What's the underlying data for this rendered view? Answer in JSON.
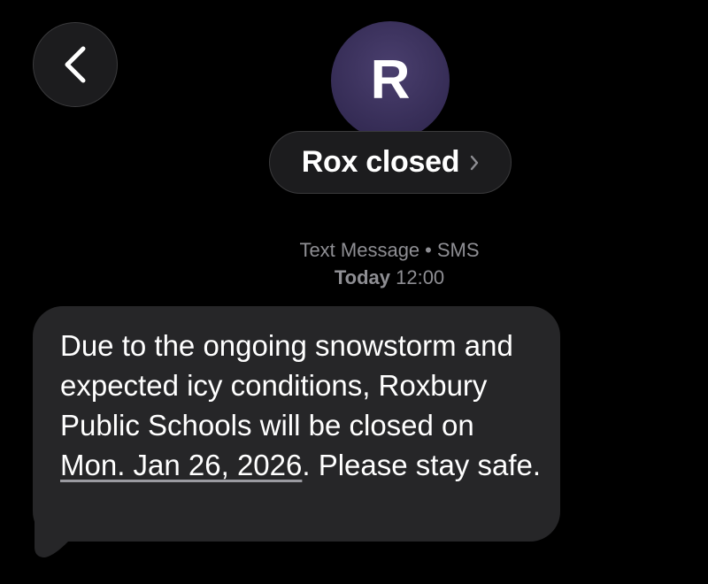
{
  "header": {
    "back_icon": "chevron-left-icon",
    "avatar_initial": "R",
    "avatar_color": "#352c55",
    "contact_name": "Rox closed",
    "contact_chevron_icon": "chevron-right-icon"
  },
  "meta": {
    "service": "Text Message",
    "separator": "•",
    "protocol": "SMS",
    "day": "Today",
    "time": "12:00"
  },
  "message": {
    "text_before": "Due to the ongoing snowstorm and expected icy conditions, Roxbury Public Schools will be closed on ",
    "date_link": "Mon. Jan 26, 2026",
    "text_after": ". Please stay safe.",
    "bubble_color": "#262628"
  }
}
